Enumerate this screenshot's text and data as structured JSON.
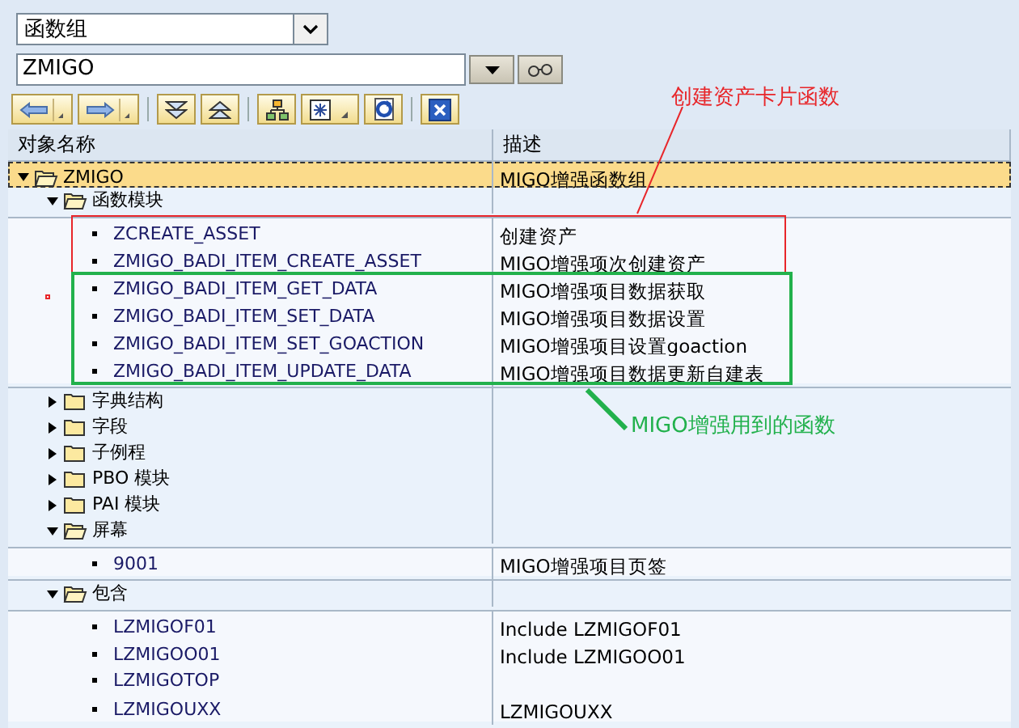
{
  "object_type": {
    "value": "函数组"
  },
  "object_name": {
    "value": "ZMIGO"
  },
  "columns": [
    "对象名称",
    "描述"
  ],
  "tree": [
    {
      "name": "ZMIGO",
      "description": "MIGO增强函数组",
      "kind": "folder",
      "expanded": true,
      "selected": true,
      "children": [
        {
          "name": "函数模块",
          "kind": "folder",
          "expanded": true,
          "selected": false,
          "children": [
            {
              "name": "ZCREATE_ASSET",
              "description": "创建资产",
              "kind": "leaf",
              "selected": false
            },
            {
              "name": "ZMIGO_BADI_ITEM_CREATE_ASSET",
              "description": "MIGO增强项次创建资产",
              "kind": "leaf",
              "selected": false
            },
            {
              "name": "ZMIGO_BADI_ITEM_GET_DATA",
              "description": "MIGO增强项目数据获取",
              "kind": "leaf",
              "selected": false
            },
            {
              "name": "ZMIGO_BADI_ITEM_SET_DATA",
              "description": "MIGO增强项目数据设置",
              "kind": "leaf",
              "selected": false
            },
            {
              "name": "ZMIGO_BADI_ITEM_SET_GOACTION",
              "description": "MIGO增强项目设置goaction",
              "kind": "leaf",
              "selected": false
            },
            {
              "name": "ZMIGO_BADI_ITEM_UPDATE_DATA",
              "description": "MIGO增强项目数据更新自建表",
              "kind": "leaf",
              "selected": false
            }
          ]
        },
        {
          "name": "字典结构",
          "kind": "folder",
          "expanded": false,
          "selected": false
        },
        {
          "name": "字段",
          "kind": "folder",
          "expanded": false,
          "selected": false
        },
        {
          "name": "子例程",
          "kind": "folder",
          "expanded": false,
          "selected": false
        },
        {
          "name": "PBO 模块",
          "kind": "folder",
          "expanded": false,
          "selected": false
        },
        {
          "name": "PAI 模块",
          "kind": "folder",
          "expanded": false,
          "selected": false
        },
        {
          "name": "屏幕",
          "kind": "folder",
          "expanded": true,
          "selected": false,
          "children": [
            {
              "name": "9001",
              "description": "MIGO增强项目页签",
              "kind": "leaf",
              "selected": false
            }
          ]
        },
        {
          "name": "包含",
          "kind": "folder",
          "expanded": true,
          "selected": false,
          "children": [
            {
              "name": "LZMIGOF01",
              "description": "Include LZMIGOF01",
              "kind": "leaf",
              "selected": false
            },
            {
              "name": "LZMIGOO01",
              "description": "Include LZMIGOO01",
              "kind": "leaf",
              "selected": false
            },
            {
              "name": "LZMIGOTOP",
              "kind": "leaf",
              "selected": false
            },
            {
              "name": "LZMIGOUXX",
              "description": "LZMIGOUXX",
              "kind": "leaf",
              "selected": false
            }
          ]
        }
      ]
    }
  ],
  "annotations": [
    {
      "text": "创建资产卡片函数",
      "color": "#e8262a"
    },
    {
      "text": "MIGO增强用到的函数",
      "color": "#22b14c"
    }
  ]
}
